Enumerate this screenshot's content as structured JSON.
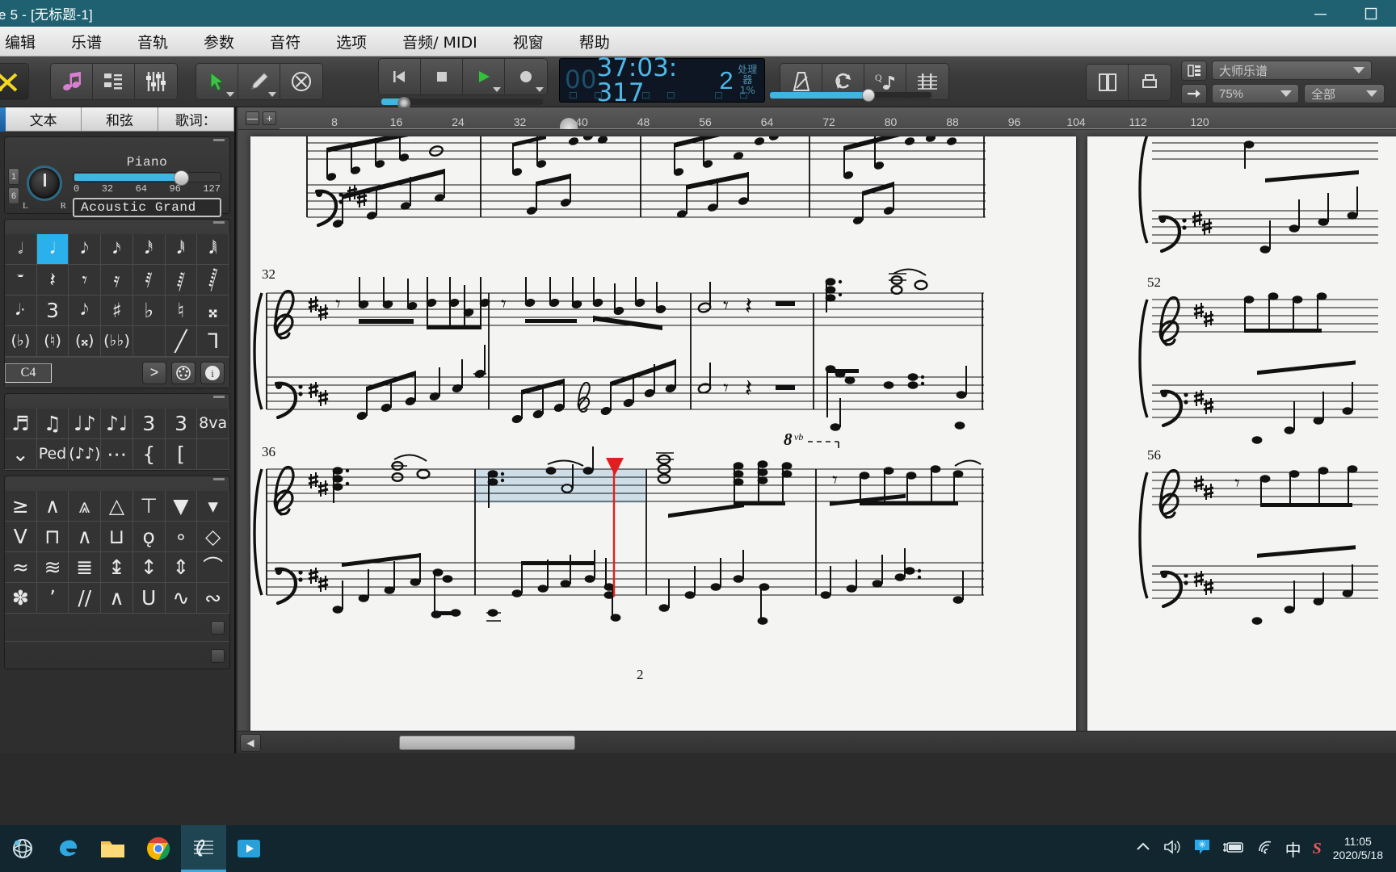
{
  "window": {
    "title": "e 5 - [无标题-1]",
    "minimize_label": "—",
    "maximize_label": "▢",
    "close_label": "✕"
  },
  "menubar": {
    "items": [
      {
        "label": "编辑"
      },
      {
        "label": "乐谱"
      },
      {
        "label": "音轨"
      },
      {
        "label": "参数"
      },
      {
        "label": "音符"
      },
      {
        "label": "选项"
      },
      {
        "label": "音频/ MIDI"
      },
      {
        "label": "视窗"
      },
      {
        "label": "帮助"
      }
    ]
  },
  "toolbar": {
    "tools_icon": "scissors-tools-icon",
    "note_icon": "music-note-icon",
    "list_icon": "track-list-icon",
    "mixer_icon": "mixer-sliders-icon",
    "select_icon": "arrow-select-icon",
    "pencil_icon": "pencil-icon",
    "erase_icon": "erase-circle-icon",
    "rewind_icon": "rewind-icon",
    "stop_icon": "stop-icon",
    "play_icon": "play-icon",
    "record_icon": "record-icon",
    "metronome_icon": "metronome-icon",
    "loop_icon": "loop-icon",
    "quantize_icon": "quantize-note-icon",
    "staff_icon": "staff-view-icon",
    "copy_icon": "copy-pages-icon",
    "print_icon": "print-icon"
  },
  "lcd": {
    "hours": "00",
    "time": "37:03: 317",
    "beat": "2",
    "cpu_label": "处理器",
    "cpu_value": "1%"
  },
  "viewbar": {
    "layout_icon": "page-layout-icon",
    "score_style": "大师乐谱",
    "goto_icon": "goto-arrow-icon",
    "zoom": "75%",
    "filter": "全部"
  },
  "left_panel": {
    "tabs": [
      {
        "label": "文本"
      },
      {
        "label": "和弦"
      },
      {
        "label": "歌词："
      }
    ],
    "track": {
      "num_top": "1",
      "num_bottom": "6",
      "pan_left": "L",
      "pan_right": "R",
      "instrument": "Piano",
      "volume_scale": [
        "0",
        "32",
        "64",
        "96",
        "127"
      ],
      "patch": "Acoustic Grand"
    },
    "note_palette": {
      "rows": [
        [
          {
            "icon": "half-note",
            "glyph": "𝅗𝅥",
            "selected": false
          },
          {
            "icon": "quarter-note",
            "glyph": "𝅘𝅥",
            "selected": true
          },
          {
            "icon": "eighth-note",
            "glyph": "𝅘𝅥𝅮",
            "selected": false
          },
          {
            "icon": "sixteenth-note",
            "glyph": "𝅘𝅥𝅯",
            "selected": false
          },
          {
            "icon": "thirtysecond-note",
            "glyph": "𝅘𝅥𝅰",
            "selected": false
          },
          {
            "icon": "sixtyfourth-note",
            "glyph": "𝅘𝅥𝅱",
            "selected": false
          },
          {
            "icon": "onetwentyeighth-note",
            "glyph": "𝅘𝅥𝅲",
            "selected": false
          }
        ],
        [
          {
            "icon": "whole-rest",
            "glyph": "𝄻",
            "selected": false
          },
          {
            "icon": "quarter-rest",
            "glyph": "𝄽",
            "selected": false
          },
          {
            "icon": "eighth-rest",
            "glyph": "𝄾",
            "selected": false
          },
          {
            "icon": "sixteenth-rest",
            "glyph": "𝄿",
            "selected": false
          },
          {
            "icon": "thirtysecond-rest",
            "glyph": "𝅀",
            "selected": false
          },
          {
            "icon": "sixtyfourth-rest",
            "glyph": "𝅁",
            "selected": false
          },
          {
            "icon": "onetwentyeighth-rest",
            "glyph": "𝅂",
            "selected": false
          }
        ],
        [
          {
            "icon": "dotted-note",
            "glyph": "𝅘𝅥·",
            "selected": false
          },
          {
            "icon": "triplet",
            "glyph": "3",
            "selected": false
          },
          {
            "icon": "grace-note",
            "glyph": "𝅘𝅥𝅮",
            "selected": false
          },
          {
            "icon": "sharp",
            "glyph": "♯",
            "selected": false
          },
          {
            "icon": "flat",
            "glyph": "♭",
            "selected": false
          },
          {
            "icon": "natural",
            "glyph": "♮",
            "selected": false
          },
          {
            "icon": "double-sharp",
            "glyph": "𝄪",
            "selected": false
          }
        ],
        [
          {
            "icon": "paren-flat",
            "glyph": "(♭)",
            "selected": false
          },
          {
            "icon": "paren-natural",
            "glyph": "(♮)",
            "selected": false
          },
          {
            "icon": "paren-double-sharp",
            "glyph": "(𝄪)",
            "selected": false
          },
          {
            "icon": "paren-double-flat",
            "glyph": "(♭♭)",
            "selected": false
          },
          {
            "icon": "blank-1",
            "glyph": "",
            "selected": false
          },
          {
            "icon": "stem-line",
            "glyph": "╱",
            "selected": false
          },
          {
            "icon": "slur-hook",
            "glyph": "ᒣ",
            "selected": false
          }
        ]
      ],
      "pitch_value": "C4",
      "accent_icon": "accent-icon",
      "midi_icon": "midi-port-icon",
      "info_icon": "info-icon"
    },
    "beam_palette": {
      "rows": [
        [
          {
            "icon": "beamed-notes-dotted",
            "glyph": "♬"
          },
          {
            "icon": "tied-notes",
            "glyph": "♫"
          },
          {
            "icon": "dotted-rhythm",
            "glyph": "♩♪"
          },
          {
            "icon": "swing-rhythm",
            "glyph": "♪♩"
          },
          {
            "icon": "triplet-group",
            "glyph": "3"
          },
          {
            "icon": "triplet-dotted-group",
            "glyph": "3"
          },
          {
            "icon": "ottava",
            "glyph": "8va"
          }
        ],
        [
          {
            "icon": "crescendo-hairpin",
            "glyph": "⌄"
          },
          {
            "icon": "pedal-mark",
            "glyph": "Ped"
          },
          {
            "icon": "tremolo-notes",
            "glyph": "(♪♪)"
          },
          {
            "icon": "glissando",
            "glyph": "⋯"
          },
          {
            "icon": "brace",
            "glyph": "{"
          },
          {
            "icon": "bracket",
            "glyph": "["
          },
          {
            "icon": "blank-2",
            "glyph": ""
          }
        ]
      ]
    },
    "articulation_palette": {
      "rows": [
        [
          {
            "icon": "marcato-accent",
            "glyph": "≥"
          },
          {
            "icon": "accent-up",
            "glyph": "∧"
          },
          {
            "icon": "accent-staccato",
            "glyph": "⩓"
          },
          {
            "icon": "marcato-triangle",
            "glyph": "△"
          },
          {
            "icon": "tenuto-staccato",
            "glyph": "⊤"
          },
          {
            "icon": "marcato-down",
            "glyph": "▼"
          },
          {
            "icon": "wedge-down",
            "glyph": "▾"
          }
        ],
        [
          {
            "icon": "upbow",
            "glyph": "V"
          },
          {
            "icon": "downbow",
            "glyph": "⊓"
          },
          {
            "icon": "accent-caret",
            "glyph": "∧"
          },
          {
            "icon": "bracket-down",
            "glyph": "⊔"
          },
          {
            "icon": "harmonic-stopped",
            "glyph": "ǫ"
          },
          {
            "icon": "harmonic-circle",
            "glyph": "∘"
          },
          {
            "icon": "diamond-note",
            "glyph": "◇"
          }
        ],
        [
          {
            "icon": "tremolo-one",
            "glyph": "≈"
          },
          {
            "icon": "tremolo-two",
            "glyph": "≋"
          },
          {
            "icon": "tremolo-three",
            "glyph": "≣"
          },
          {
            "icon": "mordent-upper",
            "glyph": "↨"
          },
          {
            "icon": "mordent-lower",
            "glyph": "↕"
          },
          {
            "icon": "trill-line",
            "glyph": "⇕"
          },
          {
            "icon": "fermata",
            "glyph": "⌒"
          }
        ],
        [
          {
            "icon": "snowflake-mark",
            "glyph": "✽"
          },
          {
            "icon": "comma-breath",
            "glyph": "ʼ"
          },
          {
            "icon": "caesura",
            "glyph": "//"
          },
          {
            "icon": "caret-mark",
            "glyph": "∧"
          },
          {
            "icon": "bracket-u",
            "glyph": "U"
          },
          {
            "icon": "turn-mark",
            "glyph": "∿"
          },
          {
            "icon": "inverted-turn",
            "glyph": "∾"
          }
        ]
      ]
    }
  },
  "ruler": {
    "zoom_out_label": "—",
    "zoom_in_label": "+",
    "ticks": [
      "8",
      "16",
      "24",
      "32",
      "40",
      "48",
      "56",
      "64",
      "72",
      "80",
      "88",
      "96",
      "104",
      "112",
      "120"
    ],
    "playhead_measure": "36"
  },
  "score": {
    "key_signature": "D major (2 sharps)",
    "page_number": "2",
    "measure_numbers": [
      "32",
      "36",
      "52",
      "56"
    ],
    "ottava_label": "8vb",
    "playhead_color": "#e02020",
    "selection_color": "#c6d9e8"
  },
  "scrollbar": {
    "left_arrow": "◀"
  },
  "taskbar": {
    "items": [
      {
        "icon": "windows-start-icon"
      },
      {
        "icon": "edge-browser-icon"
      },
      {
        "icon": "file-explorer-icon"
      },
      {
        "icon": "chrome-browser-icon"
      },
      {
        "icon": "overture-score-icon",
        "active": true
      },
      {
        "icon": "media-player-icon"
      }
    ],
    "tray": [
      {
        "icon": "chevron-up-icon"
      },
      {
        "icon": "volume-icon"
      },
      {
        "icon": "message-badge-icon"
      },
      {
        "icon": "battery-charging-icon"
      },
      {
        "icon": "wifi-icon"
      },
      {
        "icon": "ime-chinese-icon",
        "label": "中"
      },
      {
        "icon": "sogou-icon",
        "label": "S"
      }
    ],
    "clock": {
      "time": "11:05",
      "date": "2020/5/18"
    }
  },
  "colors": {
    "titlebar": "#1f6171",
    "accent": "#2ab0ea",
    "lcd_text": "#4db8e8",
    "playhead": "#e02020"
  }
}
